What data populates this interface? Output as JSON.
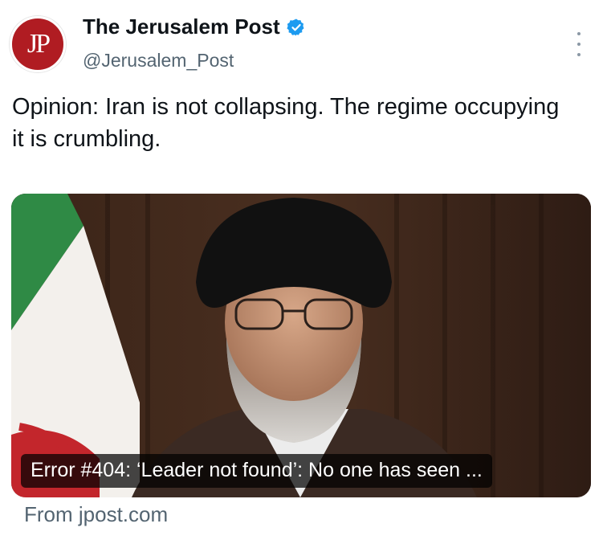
{
  "post": {
    "avatar_text": "JP",
    "author_name": "The Jerusalem Post",
    "handle": "@Jerusalem_Post",
    "text": "Opinion: Iran is not collapsing. The regime occupying it is crumbling.",
    "card": {
      "caption": "Error #404: ‘Leader not found’: No one has seen ...",
      "source": "From jpost.com"
    }
  },
  "colors": {
    "avatar_bg": "#b01c22",
    "verified": "#1d9bf0",
    "secondary_text": "#536471"
  },
  "icons": {
    "verified": "verified-badge-icon",
    "more": "more-options-icon"
  }
}
